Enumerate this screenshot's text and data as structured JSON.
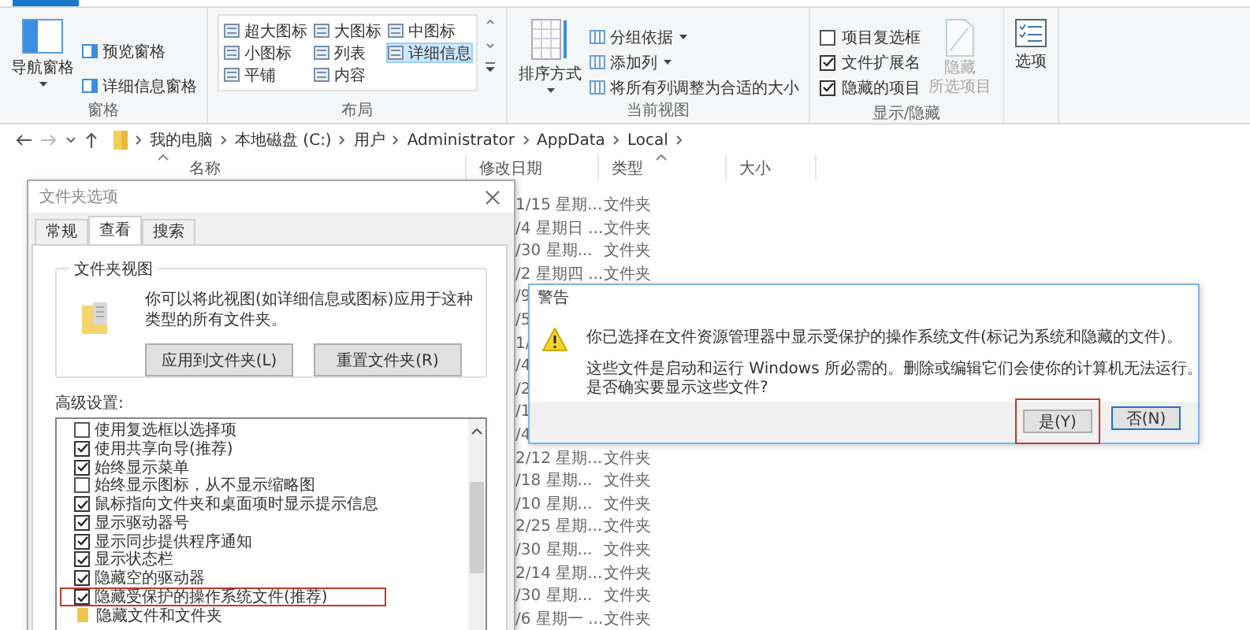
{
  "ribbon": {
    "groups": [
      {
        "kind": "panes",
        "label": "窗格",
        "big": {
          "label": "导航窗格",
          "dropdown": true
        },
        "items": [
          {
            "label": "预览窗格"
          },
          {
            "label": "详细信息窗格"
          }
        ]
      },
      {
        "kind": "layout",
        "label": "布局",
        "items": [
          {
            "label": "超大图标",
            "selected": false
          },
          {
            "label": "大图标",
            "selected": false
          },
          {
            "label": "中图标",
            "selected": false
          },
          {
            "label": "小图标",
            "selected": false
          },
          {
            "label": "列表",
            "selected": false
          },
          {
            "label": "详细信息",
            "selected": true
          },
          {
            "label": "平铺",
            "selected": false
          },
          {
            "label": "内容",
            "selected": false
          }
        ]
      },
      {
        "kind": "view",
        "label": "当前视图",
        "big": {
          "label": "排序方式",
          "dropdown": true
        },
        "items": [
          {
            "label": "分组依据",
            "dropdown": true
          },
          {
            "label": "添加列",
            "dropdown": true
          },
          {
            "label": "将所有列调整为合适的大小",
            "dropdown": false
          }
        ]
      },
      {
        "kind": "showhide",
        "label": "显示/隐藏",
        "items": [
          {
            "label": "项目复选框",
            "checked": false
          },
          {
            "label": "文件扩展名",
            "checked": true
          },
          {
            "label": "隐藏的项目",
            "checked": true
          }
        ],
        "big": {
          "lines": [
            "隐藏",
            "所选项目"
          ],
          "disabled": true
        }
      },
      {
        "kind": "options",
        "big": {
          "label": "选项"
        }
      }
    ]
  },
  "address": {
    "path": [
      "我的电脑",
      "本地磁盘 (C:)",
      "用户",
      "Administrator",
      "AppData",
      "Local"
    ]
  },
  "columns": [
    {
      "label": "名称",
      "sort_caret": true
    },
    {
      "label": "修改日期",
      "sort_caret": false
    },
    {
      "label": "类型",
      "sort_caret": true
    },
    {
      "label": "大小",
      "sort_caret": false
    }
  ],
  "rows": [
    {
      "date": "1/15 星期...",
      "type": "文件夹"
    },
    {
      "date": "/4 星期日 ...",
      "type": "文件夹"
    },
    {
      "date": "/30 星期...",
      "type": "文件夹"
    },
    {
      "date": "/2 星期四 ...",
      "type": "文件夹"
    },
    {
      "date": "/9"
    },
    {
      "date": "/5"
    },
    {
      "date": "1/"
    },
    {
      "date": "/4"
    },
    {
      "date": "/2"
    },
    {
      "date": "/1"
    },
    {
      "date": "/4"
    },
    {
      "date": "2/12 星期...",
      "type": "文件夹"
    },
    {
      "date": "/18 星期...",
      "type": "文件夹"
    },
    {
      "date": "/10 星期...",
      "type": "文件夹"
    },
    {
      "date": "2/25 星期...",
      "type": "文件夹"
    },
    {
      "date": "/30 星期...",
      "type": "文件夹"
    },
    {
      "date": "2/14 星期...",
      "type": "文件夹"
    },
    {
      "date": "/30 星期...",
      "type": "文件夹"
    },
    {
      "date": "/6 星期一 ...",
      "type": "文件夹"
    }
  ],
  "folder_options": {
    "title": "文件夹选项",
    "tabs": [
      {
        "label": "常规",
        "selected": false
      },
      {
        "label": "查看",
        "selected": true
      },
      {
        "label": "搜索",
        "selected": false
      }
    ],
    "folder_view": {
      "legend": "文件夹视图",
      "text": "你可以将此视图(如详细信息或图标)应用于这种类型的所有文件夹。",
      "buttons": [
        "应用到文件夹(L)",
        "重置文件夹(R)"
      ]
    },
    "advanced_label": "高级设置:",
    "settings": [
      {
        "kind": "checkbox",
        "label": "使用复选框以选择项",
        "checked": false,
        "highlighted": false
      },
      {
        "kind": "checkbox",
        "label": "使用共享向导(推荐)",
        "checked": true,
        "highlighted": false
      },
      {
        "kind": "checkbox",
        "label": "始终显示菜单",
        "checked": true,
        "highlighted": false
      },
      {
        "kind": "checkbox",
        "label": "始终显示图标，从不显示缩略图",
        "checked": false,
        "highlighted": false
      },
      {
        "kind": "checkbox",
        "label": "鼠标指向文件夹和桌面项时显示提示信息",
        "checked": true,
        "highlighted": false
      },
      {
        "kind": "checkbox",
        "label": "显示驱动器号",
        "checked": true,
        "highlighted": false
      },
      {
        "kind": "checkbox",
        "label": "显示同步提供程序通知",
        "checked": true,
        "highlighted": false
      },
      {
        "kind": "checkbox",
        "label": "显示状态栏",
        "checked": true,
        "highlighted": false
      },
      {
        "kind": "checkbox",
        "label": "隐藏空的驱动器",
        "checked": true,
        "highlighted": false
      },
      {
        "kind": "checkbox",
        "label": "隐藏受保护的操作系统文件(推荐)",
        "checked": true,
        "highlighted": true
      },
      {
        "kind": "folder",
        "label": "隐藏文件和文件夹"
      }
    ]
  },
  "warning": {
    "title": "警告",
    "message": "你已选择在文件资源管理器中显示受保护的操作系统文件(标记为系统和隐藏的文件)。",
    "details": [
      "这些文件是启动和运行 Windows 所必需的。删除或编辑它们会使你的计算机无法运行。",
      "是否确实要显示这些文件?"
    ],
    "buttons": [
      {
        "label": "是(Y)",
        "highlighted": true,
        "focused": false
      },
      {
        "label": "否(N)",
        "highlighted": false,
        "focused": true
      }
    ]
  }
}
